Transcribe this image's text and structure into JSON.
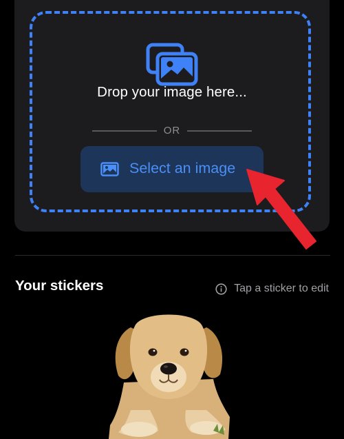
{
  "upload": {
    "drop_text": "Drop your image here...",
    "divider_text": "OR",
    "select_button_label": "Select an image"
  },
  "stickers": {
    "title": "Your stickers",
    "hint": "Tap a sticker to edit"
  },
  "icons": {
    "dropzone": "image-stack-icon",
    "button": "photo-icon",
    "info": "info-circle-icon",
    "annotation": "red-arrow-icon"
  },
  "colors": {
    "accent": "#3f82f7",
    "button_bg": "#1d3558",
    "card_bg": "#1c1c1e",
    "annotation_arrow": "#e8242f",
    "background": "#000000"
  }
}
